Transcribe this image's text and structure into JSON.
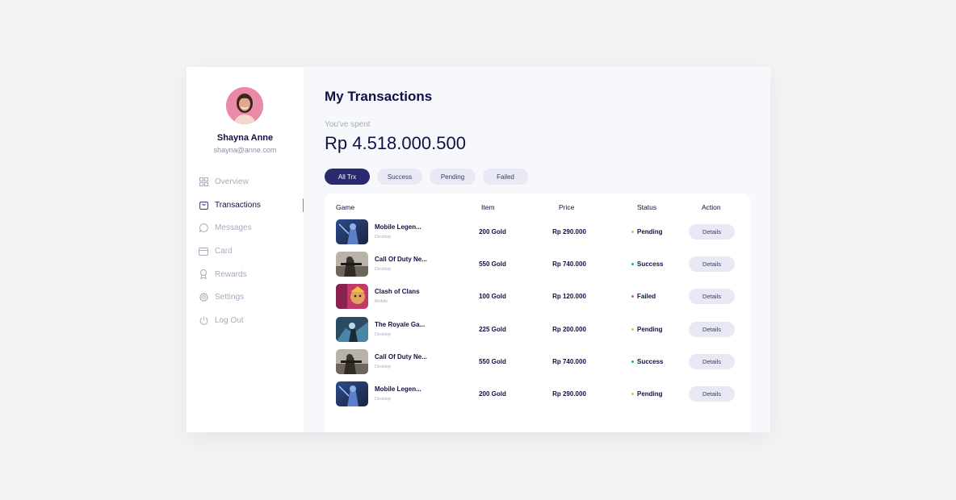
{
  "user": {
    "name": "Shayna Anne",
    "email": "shayna@anne.com"
  },
  "menu": [
    {
      "label": "Overview",
      "icon": "grid-icon",
      "active": false
    },
    {
      "label": "Transactions",
      "icon": "bag-icon",
      "active": true
    },
    {
      "label": "Messages",
      "icon": "chat-icon",
      "active": false
    },
    {
      "label": "Card",
      "icon": "card-icon",
      "active": false
    },
    {
      "label": "Rewards",
      "icon": "award-icon",
      "active": false
    },
    {
      "label": "Settings",
      "icon": "gear-icon",
      "active": false
    },
    {
      "label": "Log Out",
      "icon": "power-icon",
      "active": false
    }
  ],
  "main": {
    "title": "My Transactions",
    "spent_label": "You've spent",
    "spent_amount": "Rp 4.518.000.500"
  },
  "filters": [
    {
      "label": "All Trx",
      "active": true
    },
    {
      "label": "Success",
      "active": false
    },
    {
      "label": "Pending",
      "active": false
    },
    {
      "label": "Failed",
      "active": false
    }
  ],
  "table": {
    "headers": {
      "game": "Game",
      "item": "Item",
      "price": "Price",
      "status": "Status",
      "action": "Action"
    },
    "rows": [
      {
        "game": "Mobile Legen...",
        "platform": "Desktop",
        "item": "200 Gold",
        "price": "Rp 290.000",
        "status": "Pending",
        "action": "Details",
        "thumb": "mlbb"
      },
      {
        "game": "Call Of Duty Ne...",
        "platform": "Desktop",
        "item": "550 Gold",
        "price": "Rp 740.000",
        "status": "Success",
        "action": "Details",
        "thumb": "cod"
      },
      {
        "game": "Clash of Clans",
        "platform": "Mobile",
        "item": "100 Gold",
        "price": "Rp 120.000",
        "status": "Failed",
        "action": "Details",
        "thumb": "coc"
      },
      {
        "game": "The Royale Ga...",
        "platform": "Desktop",
        "item": "225 Gold",
        "price": "Rp 200.000",
        "status": "Pending",
        "action": "Details",
        "thumb": "royale"
      },
      {
        "game": "Call Of Duty Ne...",
        "platform": "Desktop",
        "item": "550 Gold",
        "price": "Rp 740.000",
        "status": "Success",
        "action": "Details",
        "thumb": "cod"
      },
      {
        "game": "Mobile Legen...",
        "platform": "Desktop",
        "item": "200 Gold",
        "price": "Rp 290.000",
        "status": "Pending",
        "action": "Details",
        "thumb": "mlbb"
      }
    ]
  },
  "colors": {
    "primary": "#2b2a6e",
    "accent": "#3ba3d6",
    "pending": "#f5b642",
    "success": "#22b07d",
    "failed": "#ef4f6a"
  }
}
